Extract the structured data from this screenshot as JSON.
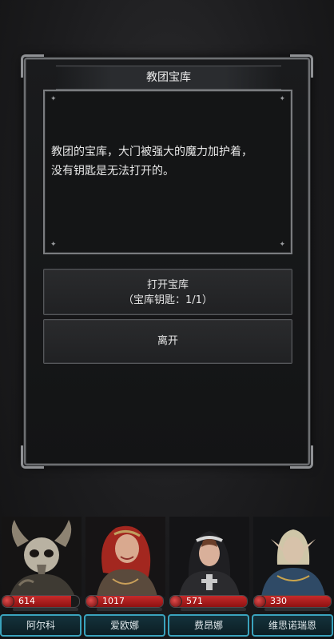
{
  "dialog": {
    "title": "教团宝库",
    "message_line1": "教团的宝库，大门被强大的魔力加护着，",
    "message_line2": "没有钥匙是无法打开的。",
    "option_open_line1": "打开宝库",
    "option_open_line2": "（宝库钥匙：1/1）",
    "option_leave": "离开"
  },
  "party": [
    {
      "name": "阿尔科",
      "hp": "614",
      "hp_fraction": 0.9,
      "portrait": "horned-skull-warrior"
    },
    {
      "name": "爱欧娜",
      "hp": "1017",
      "hp_fraction": 1.0,
      "portrait": "red-haired-warrior"
    },
    {
      "name": "费昂娜",
      "hp": "571",
      "hp_fraction": 1.0,
      "portrait": "hooded-nun"
    },
    {
      "name": "维思诺瑞恩",
      "hp": "330",
      "hp_fraction": 1.0,
      "portrait": "elf-mage"
    }
  ],
  "colors": {
    "hp_red": "#c62a2a",
    "name_tab_border": "#3aa3bd",
    "panel_border": "#6d6f72"
  }
}
